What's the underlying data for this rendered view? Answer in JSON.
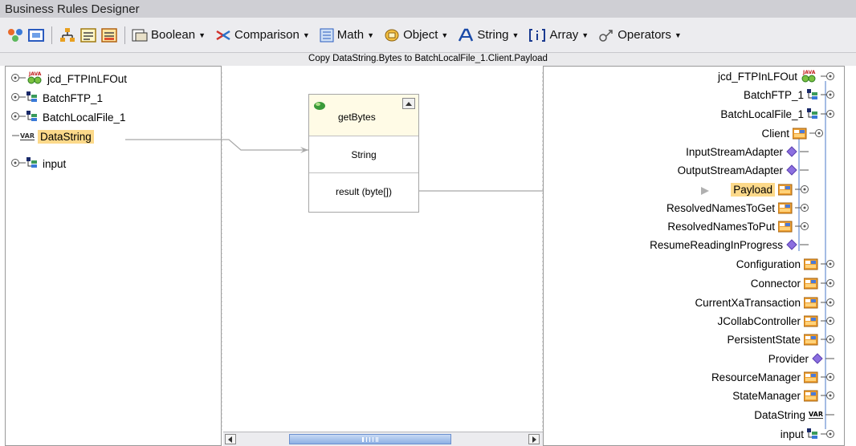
{
  "window": {
    "title": "Business Rules Designer"
  },
  "toolbar": {
    "menus": [
      {
        "label": "Boolean",
        "icon": "boolean-icon"
      },
      {
        "label": "Comparison",
        "icon": "comparison-icon"
      },
      {
        "label": "Math",
        "icon": "math-icon"
      },
      {
        "label": "Object",
        "icon": "object-icon"
      },
      {
        "label": "String",
        "icon": "string-icon"
      },
      {
        "label": "Array",
        "icon": "array-icon"
      },
      {
        "label": "Operators",
        "icon": "operators-icon"
      }
    ]
  },
  "rule": {
    "description": "Copy DataString.Bytes to BatchLocalFile_1.Client.Payload"
  },
  "left_tree": {
    "items": [
      {
        "label": "jcd_FTPInLFOut",
        "icon": "java-collab-icon"
      },
      {
        "label": "BatchFTP_1",
        "icon": "otd-icon"
      },
      {
        "label": "BatchLocalFile_1",
        "icon": "otd-icon"
      },
      {
        "label": "DataString",
        "icon": "var-icon",
        "badge": "VAR"
      },
      {
        "label": "input",
        "icon": "otd-icon"
      }
    ]
  },
  "method": {
    "name": "getBytes",
    "input_label": "String",
    "output_label": "result (byte[])"
  },
  "right_tree": {
    "items": [
      {
        "label": "jcd_FTPInLFOut",
        "icon": "java-collab-icon"
      },
      {
        "label": "BatchFTP_1",
        "icon": "otd-icon"
      },
      {
        "label": "BatchLocalFile_1",
        "icon": "otd-icon"
      },
      {
        "label": "Client",
        "icon": "node-icon"
      },
      {
        "label": "InputStreamAdapter",
        "icon": "diamond-icon"
      },
      {
        "label": "OutputStreamAdapter",
        "icon": "diamond-icon"
      },
      {
        "label": "Payload",
        "icon": "node-icon"
      },
      {
        "label": "ResolvedNamesToGet",
        "icon": "node-icon"
      },
      {
        "label": "ResolvedNamesToPut",
        "icon": "node-icon"
      },
      {
        "label": "ResumeReadingInProgress",
        "icon": "diamond-icon"
      },
      {
        "label": "Configuration",
        "icon": "node-icon"
      },
      {
        "label": "Connector",
        "icon": "node-icon"
      },
      {
        "label": "CurrentXaTransaction",
        "icon": "node-icon"
      },
      {
        "label": "JCollabController",
        "icon": "node-icon"
      },
      {
        "label": "PersistentState",
        "icon": "node-icon"
      },
      {
        "label": "Provider",
        "icon": "diamond-icon"
      },
      {
        "label": "ResourceManager",
        "icon": "node-icon"
      },
      {
        "label": "StateManager",
        "icon": "node-icon"
      },
      {
        "label": "DataString",
        "icon": "var-icon",
        "badge": "VAR"
      },
      {
        "label": "input",
        "icon": "otd-icon"
      }
    ]
  },
  "colors": {
    "highlight": "#fcd98a",
    "panel_border": "#999999",
    "node_orange": "#f0a030",
    "diamond": "#8b6fe0"
  }
}
